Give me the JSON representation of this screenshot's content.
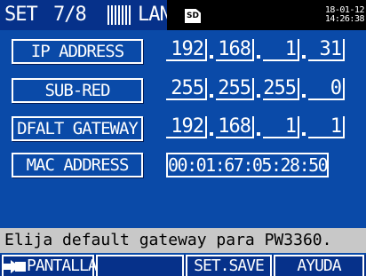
{
  "header": {
    "set_label": "SET",
    "page_indicator": "7/8",
    "tab_label": "LAN",
    "sd_label": "SD",
    "date": "18-01-12",
    "time": "14:26:38"
  },
  "settings": {
    "ip_address": {
      "label": "IP ADDRESS",
      "octets": [
        "192",
        "168",
        "1",
        "31"
      ]
    },
    "subnet": {
      "label": "SUB-RED",
      "octets": [
        "255",
        "255",
        "255",
        "0"
      ]
    },
    "gateway": {
      "label": "DFALT GATEWAY",
      "octets": [
        "192",
        "168",
        "1",
        "1"
      ]
    },
    "mac": {
      "label": "MAC ADDRESS",
      "value": "00:01:67:05:28:50"
    }
  },
  "message": "Elija default gateway para PW3360.",
  "footer": {
    "f1": "PANTALLA",
    "f2": "",
    "f3": "SET.SAVE",
    "f4": "AYUDA"
  },
  "colors": {
    "background": "#0a4aa8",
    "header_bar": "#06318a",
    "message_bar": "#c8c8c8",
    "text": "#ffffff"
  }
}
